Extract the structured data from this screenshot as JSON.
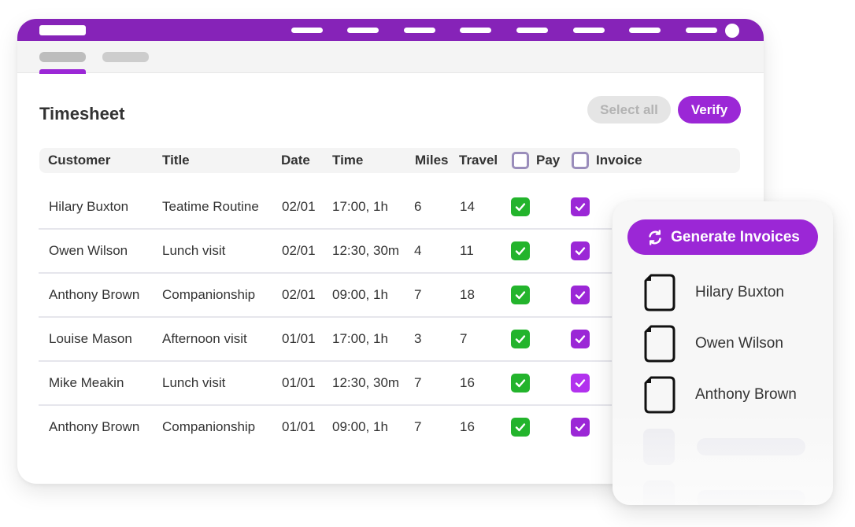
{
  "colors": {
    "brand": "#8623b8",
    "accent": "#9b27d6",
    "pay_check": "#23b42c",
    "invoice_check": "#9b27d6",
    "header_checkbox_border": "#9a8dbb"
  },
  "page": {
    "title": "Timesheet"
  },
  "toolbar": {
    "select_all_label": "Select all",
    "verify_label": "Verify"
  },
  "table": {
    "columns": {
      "customer": "Customer",
      "title": "Title",
      "date": "Date",
      "time": "Time",
      "miles": "Miles",
      "travel": "Travel",
      "pay": "Pay",
      "invoice": "Invoice"
    },
    "header_pay_checked": false,
    "header_invoice_checked": false,
    "rows": [
      {
        "customer": "Hilary Buxton",
        "title": "Teatime Routine",
        "date": "02/01",
        "time": "17:00, 1h",
        "miles": "6",
        "travel": "14",
        "pay": true,
        "invoice": true
      },
      {
        "customer": "Owen Wilson",
        "title": "Lunch visit",
        "date": "02/01",
        "time": "12:30, 30m",
        "miles": "4",
        "travel": "11",
        "pay": true,
        "invoice": true
      },
      {
        "customer": "Anthony Brown",
        "title": "Companionship",
        "date": "02/01",
        "time": "09:00, 1h",
        "miles": "7",
        "travel": "18",
        "pay": true,
        "invoice": true
      },
      {
        "customer": "Louise Mason",
        "title": "Afternoon visit",
        "date": "01/01",
        "time": "17:00, 1h",
        "miles": "3",
        "travel": "7",
        "pay": true,
        "invoice": true
      },
      {
        "customer": "Mike Meakin",
        "title": "Lunch visit",
        "date": "01/01",
        "time": "12:30, 30m",
        "miles": "7",
        "travel": "16",
        "pay": true,
        "invoice": true
      },
      {
        "customer": "Anthony Brown",
        "title": "Companionship",
        "date": "01/01",
        "time": "09:00, 1h",
        "miles": "7",
        "travel": "16",
        "pay": true,
        "invoice": true
      }
    ]
  },
  "invoice_panel": {
    "generate_label": "Generate Invoices",
    "generate_icon": "refresh-icon",
    "items": [
      {
        "name": "Hilary Buxton",
        "icon": "document-icon"
      },
      {
        "name": "Owen Wilson",
        "icon": "document-icon"
      },
      {
        "name": "Anthony Brown",
        "icon": "document-icon"
      }
    ]
  }
}
